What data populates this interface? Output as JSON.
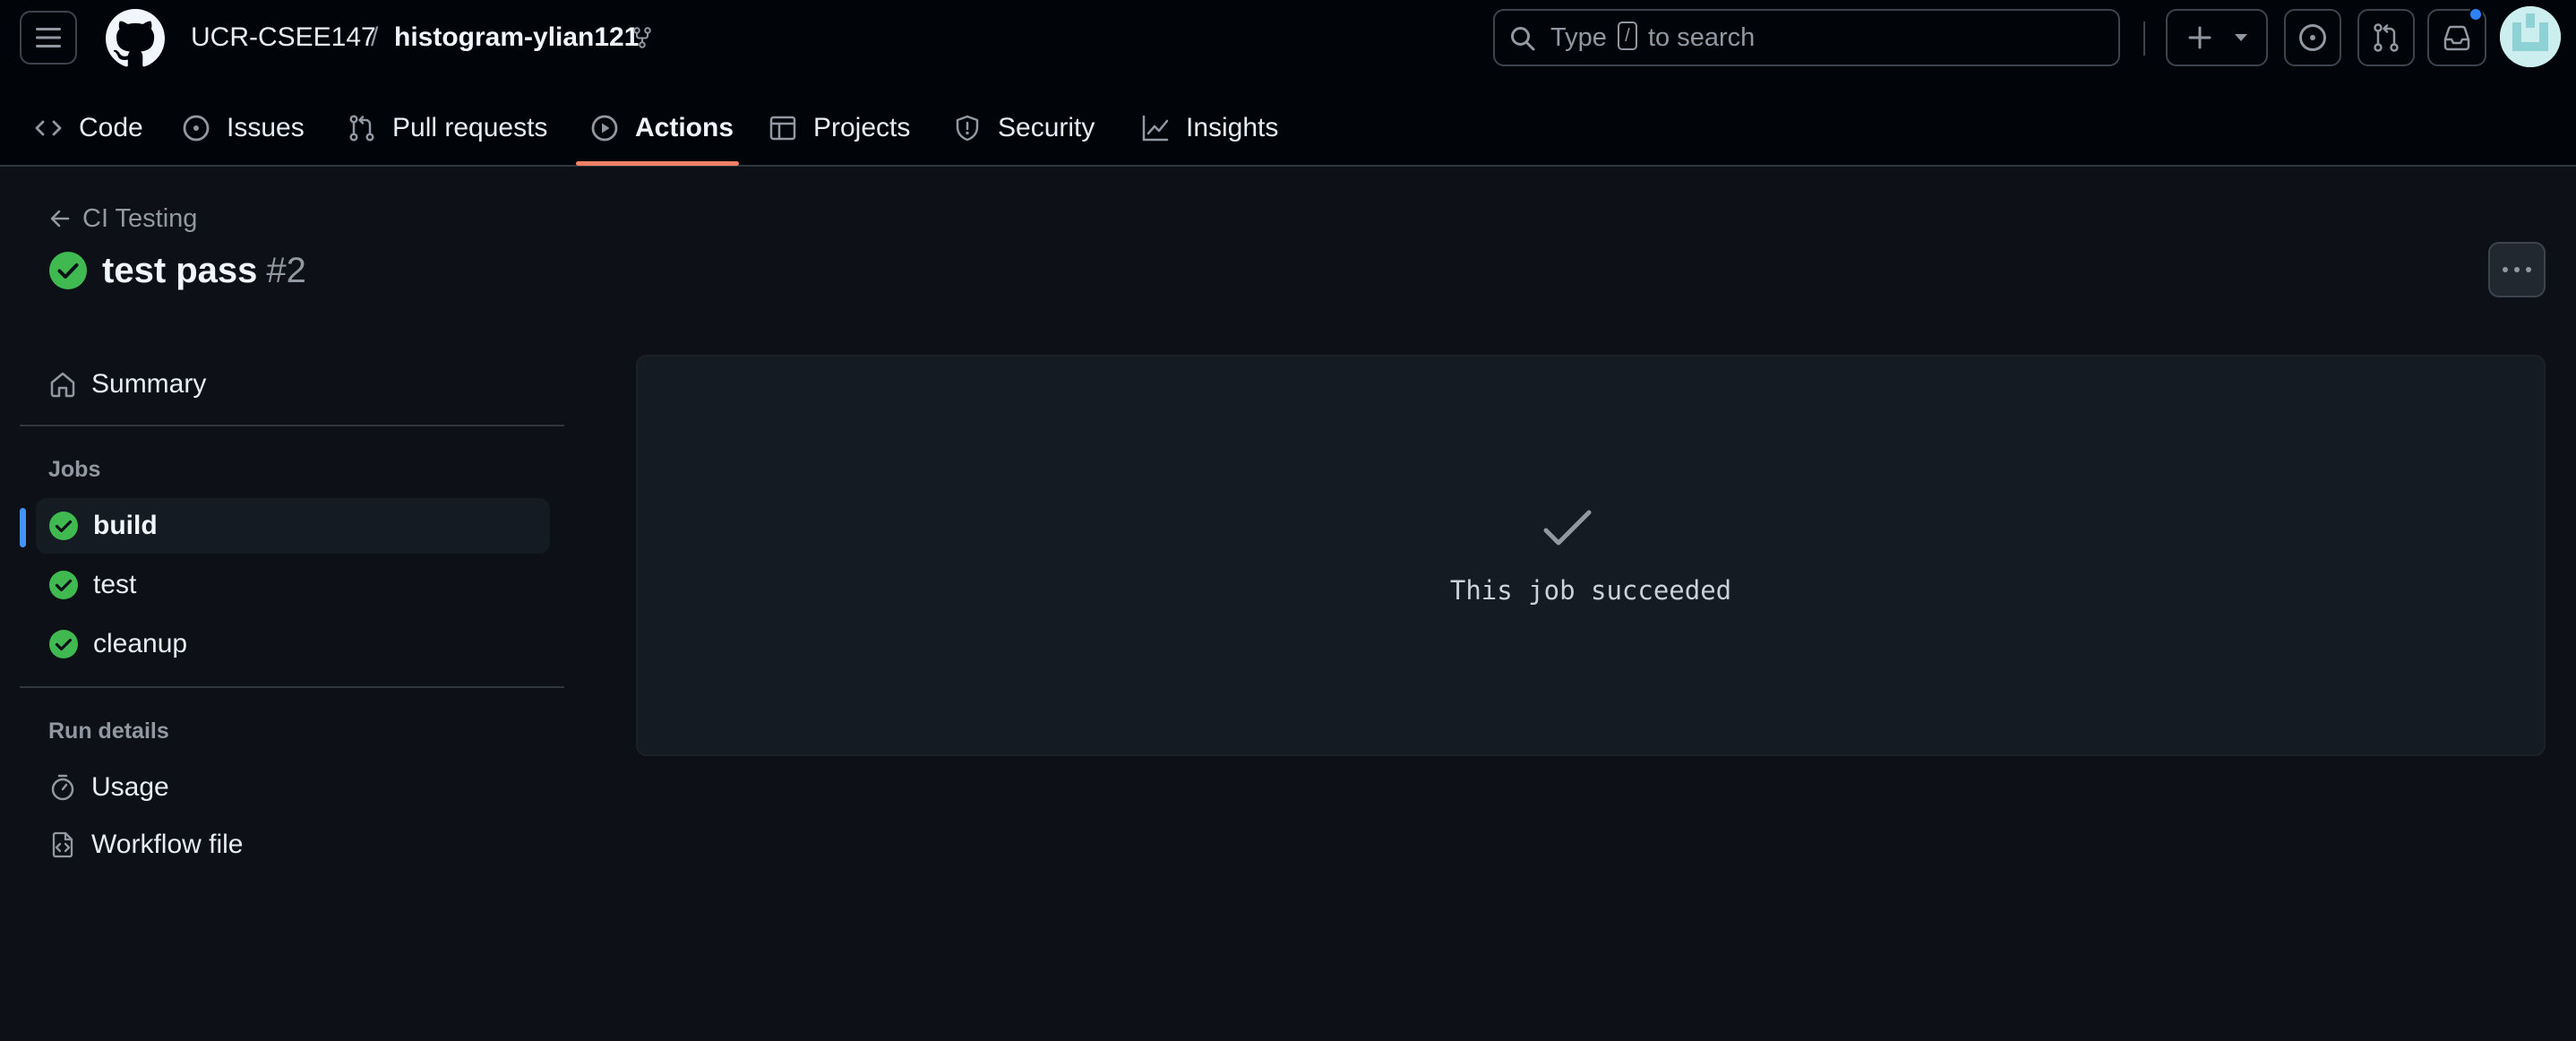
{
  "header": {
    "owner": "UCR-CSEE147",
    "separator": "/",
    "repo": "histogram-ylian121",
    "search_prefix": "Type",
    "search_key": "/",
    "search_suffix": "to search"
  },
  "nav": {
    "tabs": [
      {
        "label": "Code"
      },
      {
        "label": "Issues"
      },
      {
        "label": "Pull requests"
      },
      {
        "label": "Actions",
        "selected": true
      },
      {
        "label": "Projects"
      },
      {
        "label": "Security"
      },
      {
        "label": "Insights"
      }
    ]
  },
  "run": {
    "back_label": "CI Testing",
    "title": "test pass",
    "number": "#2",
    "status": "success"
  },
  "sidebar": {
    "summary_label": "Summary",
    "jobs_heading": "Jobs",
    "jobs": [
      {
        "label": "build",
        "status": "success",
        "selected": true
      },
      {
        "label": "test",
        "status": "success"
      },
      {
        "label": "cleanup",
        "status": "success"
      }
    ],
    "run_details_heading": "Run details",
    "details": [
      {
        "label": "Usage",
        "icon": "stopwatch-icon"
      },
      {
        "label": "Workflow file",
        "icon": "file-code-icon"
      }
    ]
  },
  "main": {
    "message": "This job succeeded"
  },
  "colors": {
    "success": "#3fb950",
    "accent_underline": "#f78166",
    "selected_marker": "#4493f8",
    "notification": "#2f81f7"
  }
}
